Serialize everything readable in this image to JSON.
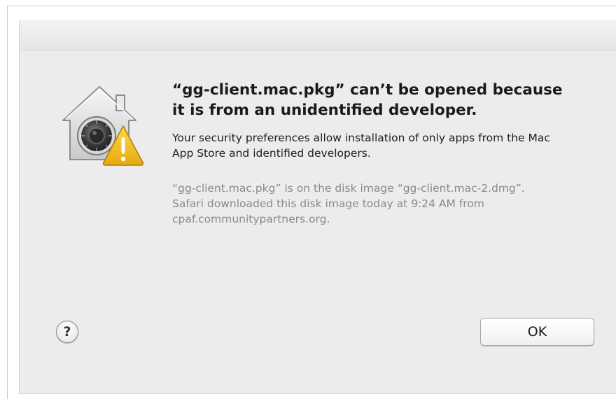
{
  "dialog": {
    "headline": "“gg-client.mac.pkg” can’t be opened because it is from an unidentified developer.",
    "message": "Your security preferences allow installation of only apps from the Mac App Store and identified developers.",
    "detail": "“gg-client.mac.pkg” is on the disk image “gg-client.mac-2.dmg”. Safari downloaded this disk image today at 9:24 AM from cpaf.communitypartners.org.",
    "help_label": "?",
    "ok_label": "OK",
    "icon": "gatekeeper-security-warning-icon"
  },
  "colors": {
    "dialog_background": "#ececec",
    "headline_text": "#1a1a1a",
    "detail_text": "#8a8a8a",
    "warning_yellow": "#f2c21b"
  }
}
